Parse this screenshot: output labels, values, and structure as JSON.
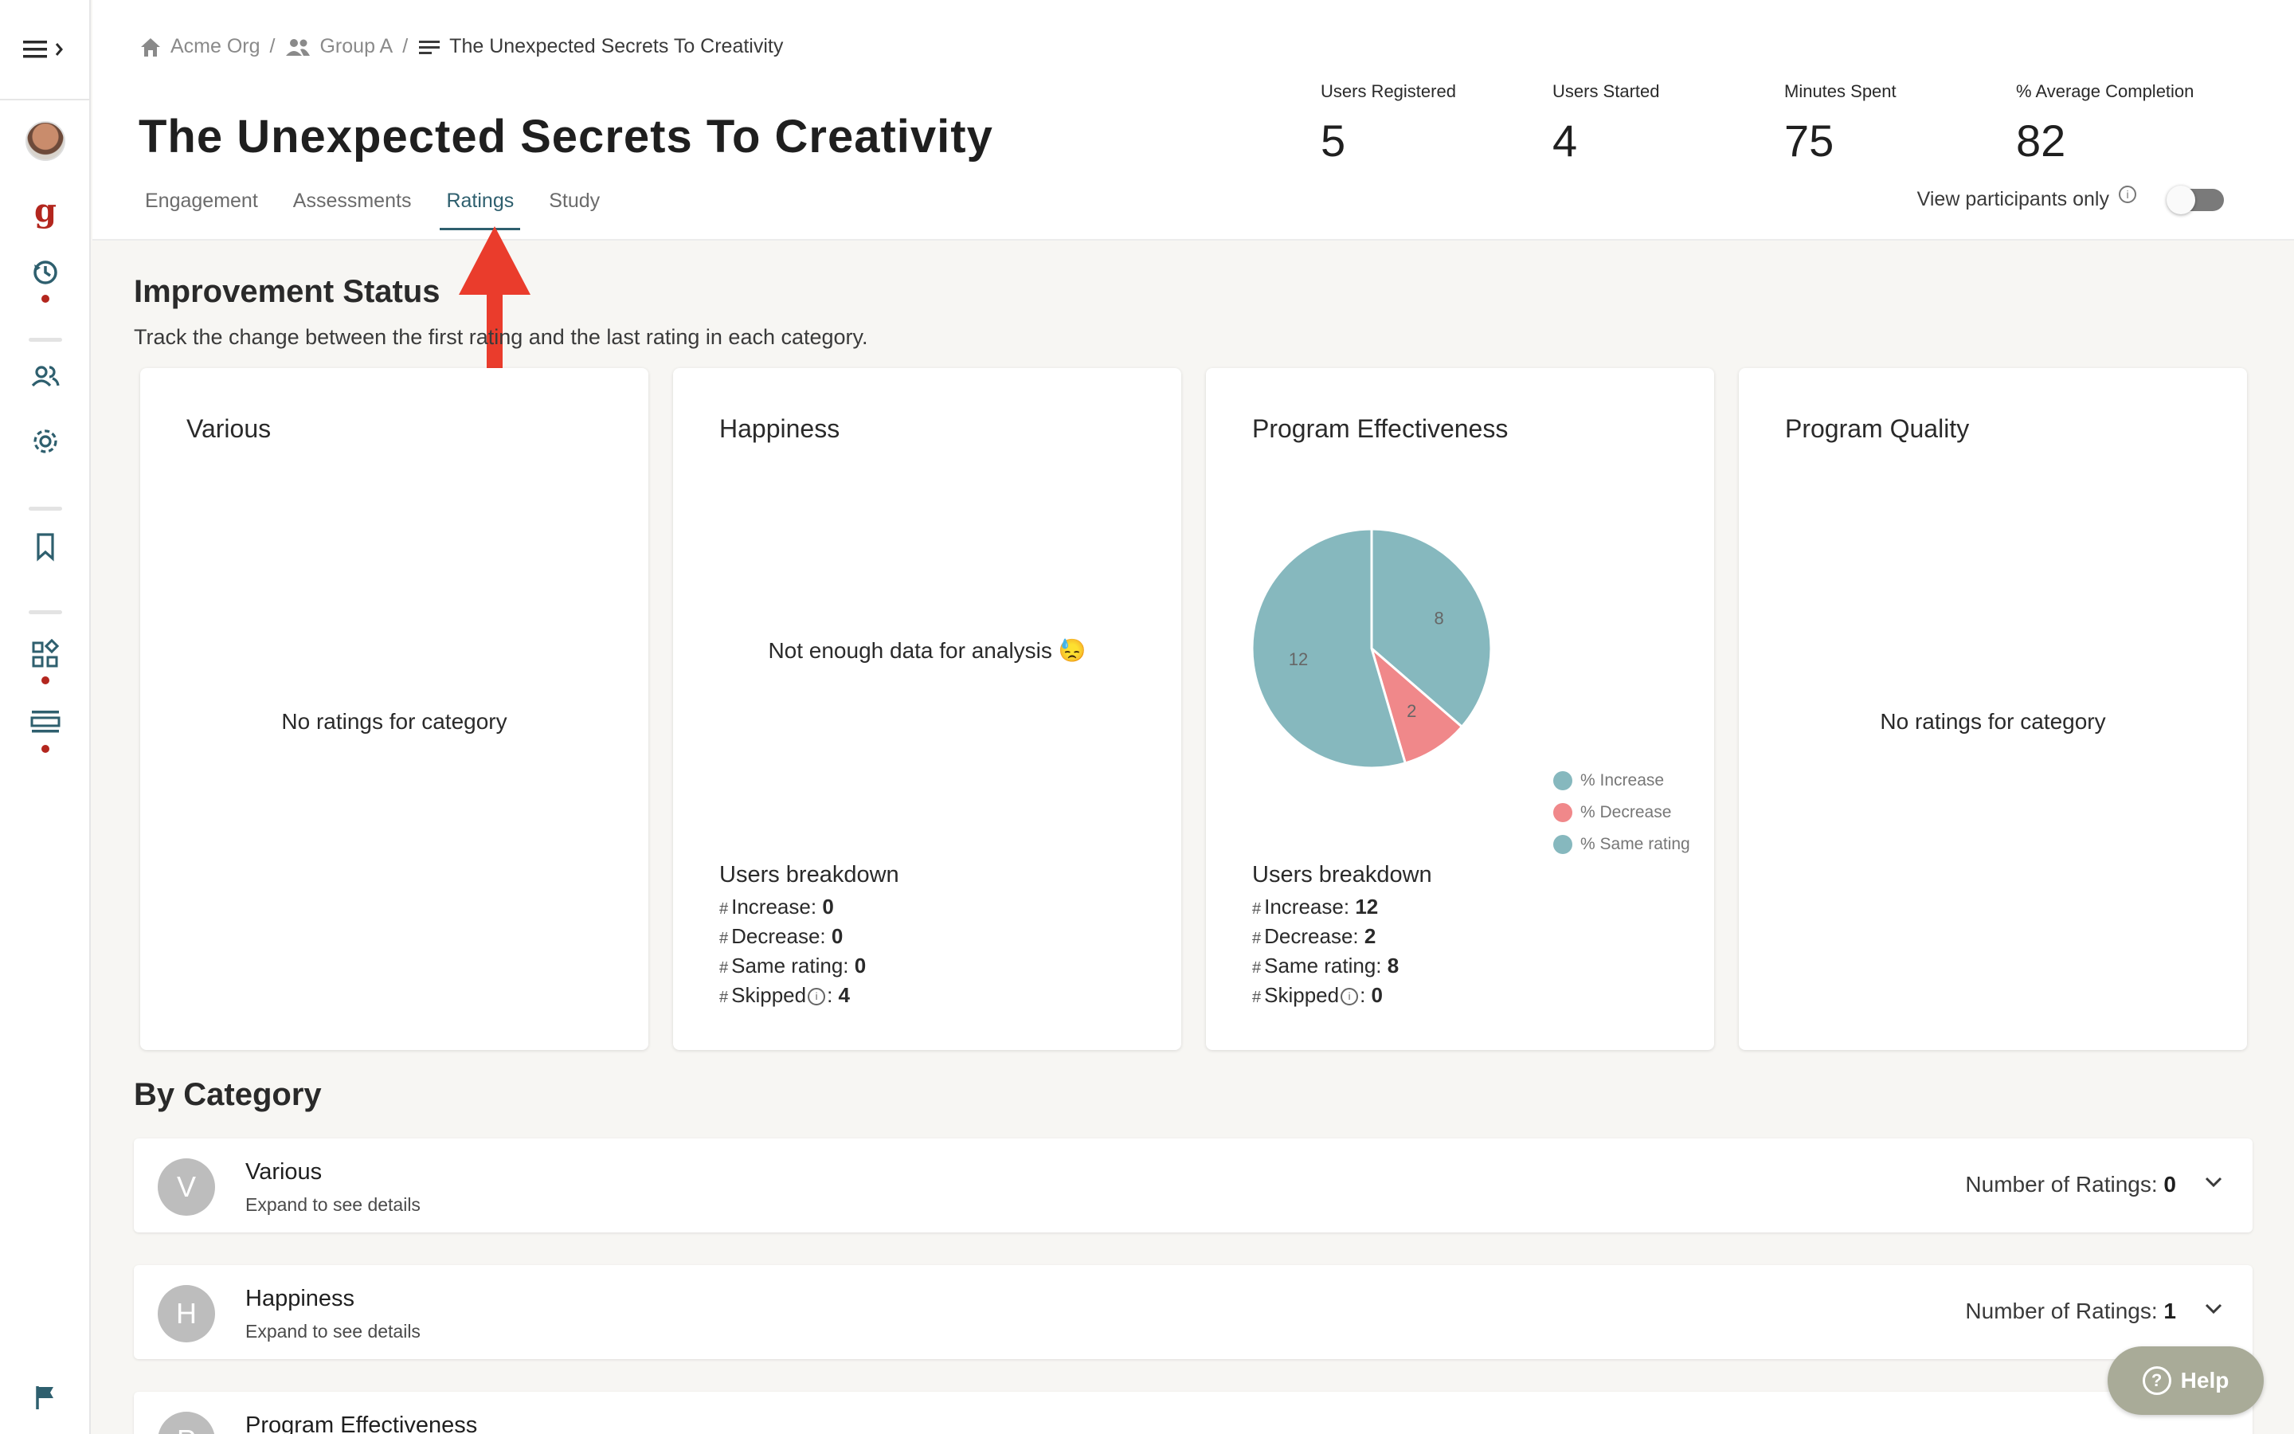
{
  "breadcrumb": {
    "org": "Acme Org",
    "group": "Group A",
    "current": "The Unexpected Secrets To Creativity",
    "sep": "/"
  },
  "page": {
    "title": "The Unexpected Secrets To Creativity"
  },
  "tabs": [
    {
      "label": "Engagement"
    },
    {
      "label": "Assessments"
    },
    {
      "label": "Ratings",
      "active": true
    },
    {
      "label": "Study"
    }
  ],
  "stats": [
    {
      "label": "Users Registered",
      "value": "5"
    },
    {
      "label": "Users Started",
      "value": "4"
    },
    {
      "label": "Minutes Spent",
      "value": "75"
    },
    {
      "label": "% Average Completion",
      "value": "82"
    }
  ],
  "view_participants": {
    "label": "View participants only",
    "on": false,
    "info": "i"
  },
  "improvement": {
    "title": "Improvement Status",
    "subtitle": "Track the change between the first rating and the last rating in each category."
  },
  "cards": [
    {
      "title": "Various",
      "message": "No ratings for category"
    },
    {
      "title": "Happiness",
      "message": "Not enough data for analysis 😓",
      "breakdown": {
        "heading": "Users breakdown",
        "rows": [
          {
            "label": "Increase:",
            "value": "0"
          },
          {
            "label": "Decrease:",
            "value": "0"
          },
          {
            "label": "Same rating:",
            "value": "0"
          },
          {
            "label": "Skipped",
            "value": "4",
            "info": true
          }
        ]
      }
    },
    {
      "title": "Program Effectiveness",
      "breakdown": {
        "heading": "Users breakdown",
        "rows": [
          {
            "label": "Increase:",
            "value": "12"
          },
          {
            "label": "Decrease:",
            "value": "2"
          },
          {
            "label": "Same rating:",
            "value": "8"
          },
          {
            "label": "Skipped",
            "value": "0",
            "info": true
          }
        ]
      }
    },
    {
      "title": "Program Quality",
      "message": "No ratings for category"
    }
  ],
  "chart_data": {
    "type": "pie",
    "title": "",
    "slices": [
      {
        "name": "% Same rating",
        "value": 8,
        "color": "#86b8be"
      },
      {
        "name": "% Decrease",
        "value": 2,
        "color": "#f0888a"
      },
      {
        "name": "% Increase",
        "value": 12,
        "color": "#86b8be"
      }
    ],
    "legend": [
      "% Increase",
      "% Decrease",
      "% Same rating"
    ],
    "legend_colors": [
      "#86b8be",
      "#f0888a",
      "#86b8be"
    ],
    "legend_position": "right"
  },
  "by_category": {
    "title": "By Category",
    "count_label": "Number of Ratings:",
    "rows": [
      {
        "initial": "V",
        "name": "Various",
        "sub": "Expand to see details",
        "count": "0"
      },
      {
        "initial": "H",
        "name": "Happiness",
        "sub": "Expand to see details",
        "count": "1"
      },
      {
        "initial": "P",
        "name": "Program Effectiveness",
        "sub": "",
        "count": ""
      }
    ]
  },
  "help": {
    "label": "Help",
    "icon": "?"
  },
  "colors": {
    "accent": "#2e5f6e",
    "brand_red": "#b3261e",
    "arrow": "#ea3c2c"
  }
}
